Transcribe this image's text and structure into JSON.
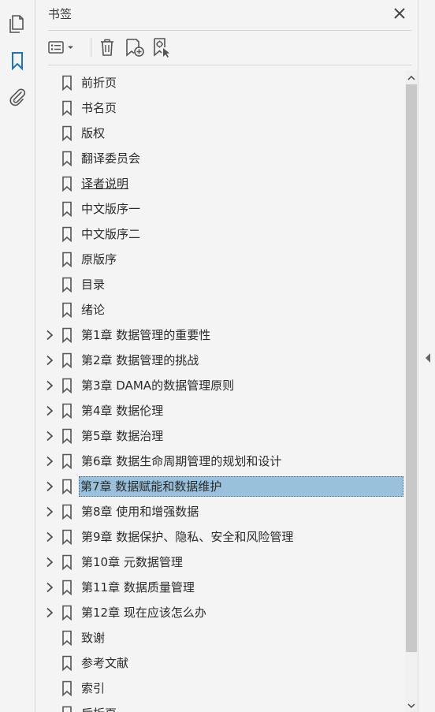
{
  "panel": {
    "title": "书签",
    "close_icon": "close-icon"
  },
  "rail": {
    "items": [
      {
        "name": "page-thumbnails-icon"
      },
      {
        "name": "bookmarks-icon"
      },
      {
        "name": "attachments-icon"
      }
    ],
    "active": "bookmarks-icon"
  },
  "toolbar": {
    "items": [
      "options-menu-icon",
      "delete-bookmark-icon",
      "new-bookmark-icon",
      "new-bookmark-from-structure-icon"
    ]
  },
  "bookmarks": [
    {
      "label": "前折页",
      "expandable": false
    },
    {
      "label": "书名页",
      "expandable": false
    },
    {
      "label": "版权",
      "expandable": false
    },
    {
      "label": "翻译委员会",
      "expandable": false
    },
    {
      "label": "译者说明",
      "expandable": false,
      "underlined": true
    },
    {
      "label": "中文版序一",
      "expandable": false
    },
    {
      "label": "中文版序二",
      "expandable": false
    },
    {
      "label": "原版序",
      "expandable": false
    },
    {
      "label": "目录",
      "expandable": false
    },
    {
      "label": "绪论",
      "expandable": false
    },
    {
      "label": "第1章 数据管理的重要性",
      "expandable": true
    },
    {
      "label": "第2章 数据管理的挑战",
      "expandable": true
    },
    {
      "label": "第3章 DAMA的数据管理原则",
      "expandable": true
    },
    {
      "label": "第4章 数据伦理",
      "expandable": true
    },
    {
      "label": "第5章 数据治理",
      "expandable": true
    },
    {
      "label": "第6章 数据生命周期管理的规划和设计",
      "expandable": true
    },
    {
      "label": "第7章 数据赋能和数据维护",
      "expandable": true,
      "selected": true
    },
    {
      "label": "第8章 使用和增强数据",
      "expandable": true
    },
    {
      "label": "第9章 数据保护、隐私、安全和风险管理",
      "expandable": true
    },
    {
      "label": "第10章 元数据管理",
      "expandable": true
    },
    {
      "label": "第11章 数据质量管理",
      "expandable": true
    },
    {
      "label": "第12章 现在应该怎么办",
      "expandable": true
    },
    {
      "label": "致谢",
      "expandable": false
    },
    {
      "label": "参考文献",
      "expandable": false
    },
    {
      "label": "索引",
      "expandable": false
    },
    {
      "label": "后折页",
      "expandable": false
    }
  ],
  "colors": {
    "selection_bg": "#99c1dc",
    "active_rail_icon": "#1a73c8",
    "icon_gray": "#555555"
  },
  "scrollbar": {
    "position_fraction": 0.0,
    "visible_fraction": 0.9
  }
}
